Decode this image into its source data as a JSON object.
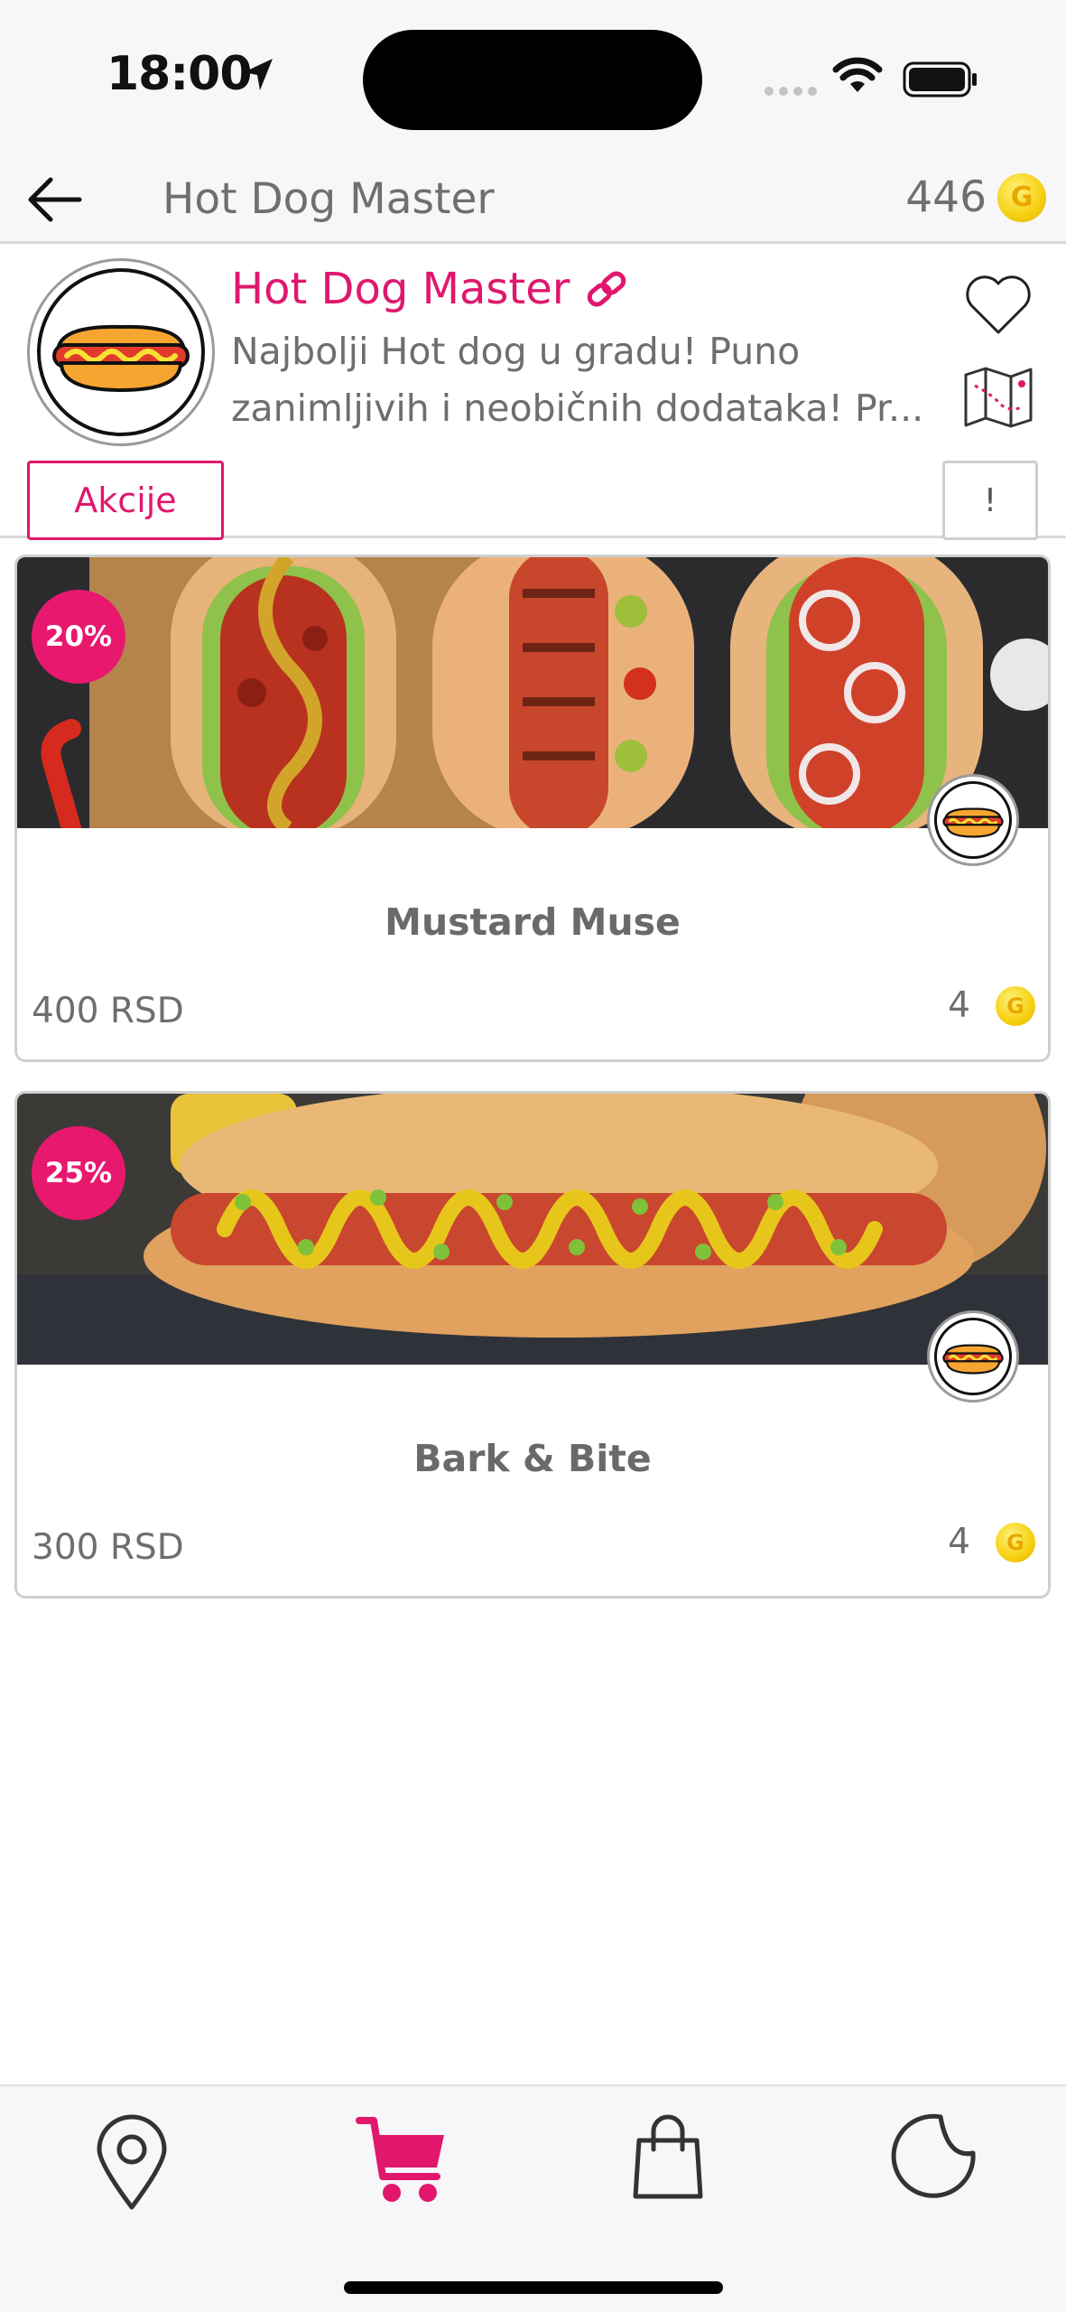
{
  "status_bar": {
    "time": "18:00"
  },
  "header": {
    "title": "Hot Dog Master",
    "coins": "446",
    "coin_symbol": "G"
  },
  "shop": {
    "name": "Hot Dog Master",
    "description_line1": "Najbolji Hot dog u gradu! Puno",
    "description_line2": "zanimljivih i neobičnih dodataka! Pr...",
    "tabs": {
      "akcije": "Akcije",
      "info": "!"
    }
  },
  "products": [
    {
      "badge": "20%",
      "title": "Mustard Muse",
      "price": "400 RSD",
      "points": "4"
    },
    {
      "badge": "25%",
      "title": "Bark & Bite",
      "price": "300 RSD",
      "points": "4"
    }
  ],
  "tabbar": {
    "items": [
      {
        "icon": "location-pin-icon",
        "active": false
      },
      {
        "icon": "cart-icon",
        "active": true
      },
      {
        "icon": "shopping-bag-icon",
        "active": false
      },
      {
        "icon": "sticker-icon",
        "active": false
      }
    ]
  },
  "colors": {
    "accent": "#e0176d",
    "coin": "#f5cf10"
  }
}
